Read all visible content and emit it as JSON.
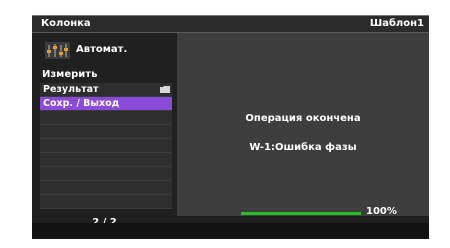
{
  "header": {
    "app_title": "Колонка",
    "template": "Шаблон1"
  },
  "mode": {
    "icon": "equalizer-icon",
    "label": "Автомат."
  },
  "measure_label": "Измерить",
  "list": {
    "items": [
      {
        "label": "Результат",
        "icon": "folder-icon",
        "selected": false
      },
      {
        "label": "Сохр. / Выход",
        "selected": true
      },
      {
        "label": ""
      },
      {
        "label": ""
      },
      {
        "label": ""
      },
      {
        "label": ""
      },
      {
        "label": ""
      },
      {
        "label": ""
      },
      {
        "label": ""
      }
    ],
    "pager": "2 / 2"
  },
  "main": {
    "status": "Операция окончена",
    "error": "W-1:Ошибка фазы"
  },
  "progress": {
    "percent": 100,
    "label": "100%"
  },
  "colors": {
    "selection": "#8c4ad8",
    "progress": "#22c022"
  }
}
